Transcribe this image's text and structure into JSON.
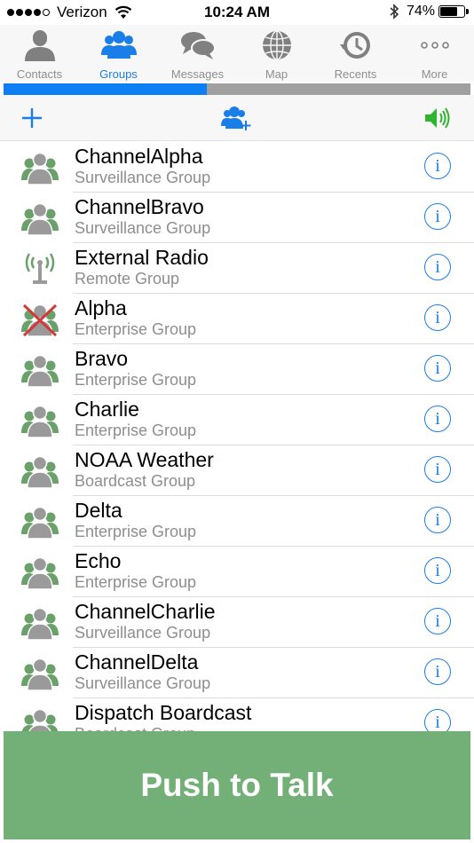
{
  "status_bar": {
    "carrier": "Verizon",
    "time": "10:24 AM",
    "battery": "74%",
    "battery_level": 0.74
  },
  "tabs": [
    {
      "label": "Contacts",
      "icon": "person-icon"
    },
    {
      "label": "Groups",
      "icon": "group-icon",
      "active": true
    },
    {
      "label": "Messages",
      "icon": "messages-icon"
    },
    {
      "label": "Map",
      "icon": "globe-icon"
    },
    {
      "label": "Recents",
      "icon": "clock-icon"
    },
    {
      "label": "More",
      "icon": "ellipsis-icon"
    }
  ],
  "progress": {
    "value": 0.435
  },
  "toolbar": {
    "add_icon": "plus-icon",
    "add_group_icon": "add-group-icon",
    "speaker_icon": "speaker-icon"
  },
  "groups": [
    {
      "name": "ChannelAlpha",
      "type": "Surveillance Group",
      "icon": "group-icon"
    },
    {
      "name": "ChannelBravo",
      "type": "Surveillance Group",
      "icon": "group-icon"
    },
    {
      "name": "External Radio",
      "type": "Remote Group",
      "icon": "radio-icon"
    },
    {
      "name": "Alpha",
      "type": "Enterprise Group",
      "icon": "group-disabled-icon"
    },
    {
      "name": "Bravo",
      "type": "Enterprise Group",
      "icon": "group-icon"
    },
    {
      "name": "Charlie",
      "type": "Enterprise Group",
      "icon": "group-icon"
    },
    {
      "name": "NOAA Weather",
      "type": "Boardcast Group",
      "icon": "group-icon"
    },
    {
      "name": "Delta",
      "type": "Enterprise Group",
      "icon": "group-icon"
    },
    {
      "name": "Echo",
      "type": "Enterprise Group",
      "icon": "group-icon"
    },
    {
      "name": "ChannelCharlie",
      "type": "Surveillance Group",
      "icon": "group-icon"
    },
    {
      "name": "ChannelDelta",
      "type": "Surveillance Group",
      "icon": "group-icon"
    },
    {
      "name": "Dispatch Boardcast",
      "type": "Boardcast Group",
      "icon": "group-icon"
    }
  ],
  "push_to_talk": {
    "label": "Push to Talk"
  },
  "colors": {
    "accent": "#1a7ee8",
    "progress": "#0e7ef5",
    "ptt": "#72b077",
    "speaker": "#2db52d",
    "group_icon": "#6aa16a"
  }
}
